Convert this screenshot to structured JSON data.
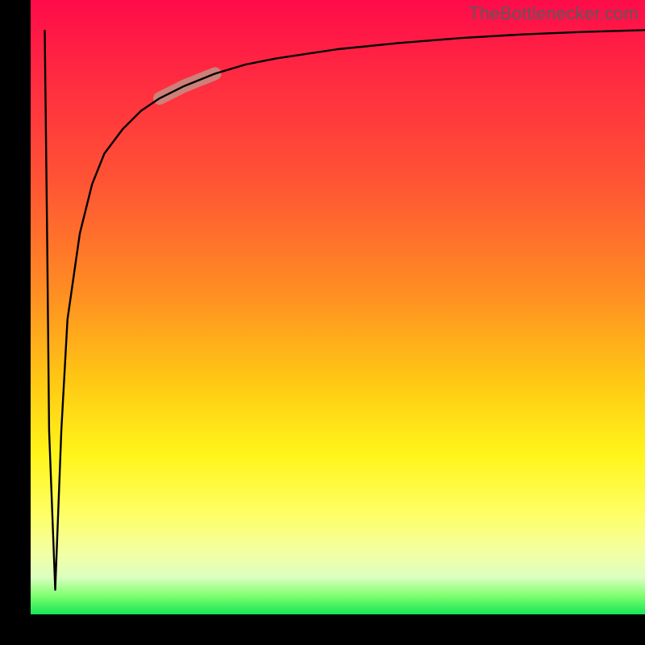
{
  "watermark": {
    "text": "TheBottlenecker.com"
  },
  "colors": {
    "frame": "#000000",
    "curve": "#000000",
    "highlight": "#c88a7e",
    "gradient_stops": [
      "#ff0b4a",
      "#ff5534",
      "#ffc814",
      "#fff51a",
      "#7fff6e",
      "#15e657"
    ]
  },
  "chart_data": {
    "type": "line",
    "title": "",
    "xlabel": "",
    "ylabel": "",
    "xlim": [
      0,
      100
    ],
    "ylim": [
      0,
      100
    ],
    "grid": false,
    "legend": false,
    "annotations": [
      {
        "kind": "highlight-segment",
        "x_range": [
          21,
          30
        ],
        "y_range": [
          83,
          87
        ],
        "color": "#c88a7e"
      }
    ],
    "series": [
      {
        "name": "curve",
        "color": "#000000",
        "x": [
          2.3,
          2.7,
          3.0,
          4.0,
          5.0,
          6.0,
          8.0,
          10,
          12,
          15,
          18,
          21,
          25,
          30,
          35,
          40,
          50,
          60,
          70,
          80,
          90,
          100
        ],
        "y": [
          95,
          60,
          30,
          4,
          30,
          48,
          62,
          70,
          75,
          79,
          82,
          84,
          86,
          88,
          89.5,
          90.5,
          92,
          93,
          93.8,
          94.4,
          94.8,
          95.1
        ]
      }
    ]
  }
}
